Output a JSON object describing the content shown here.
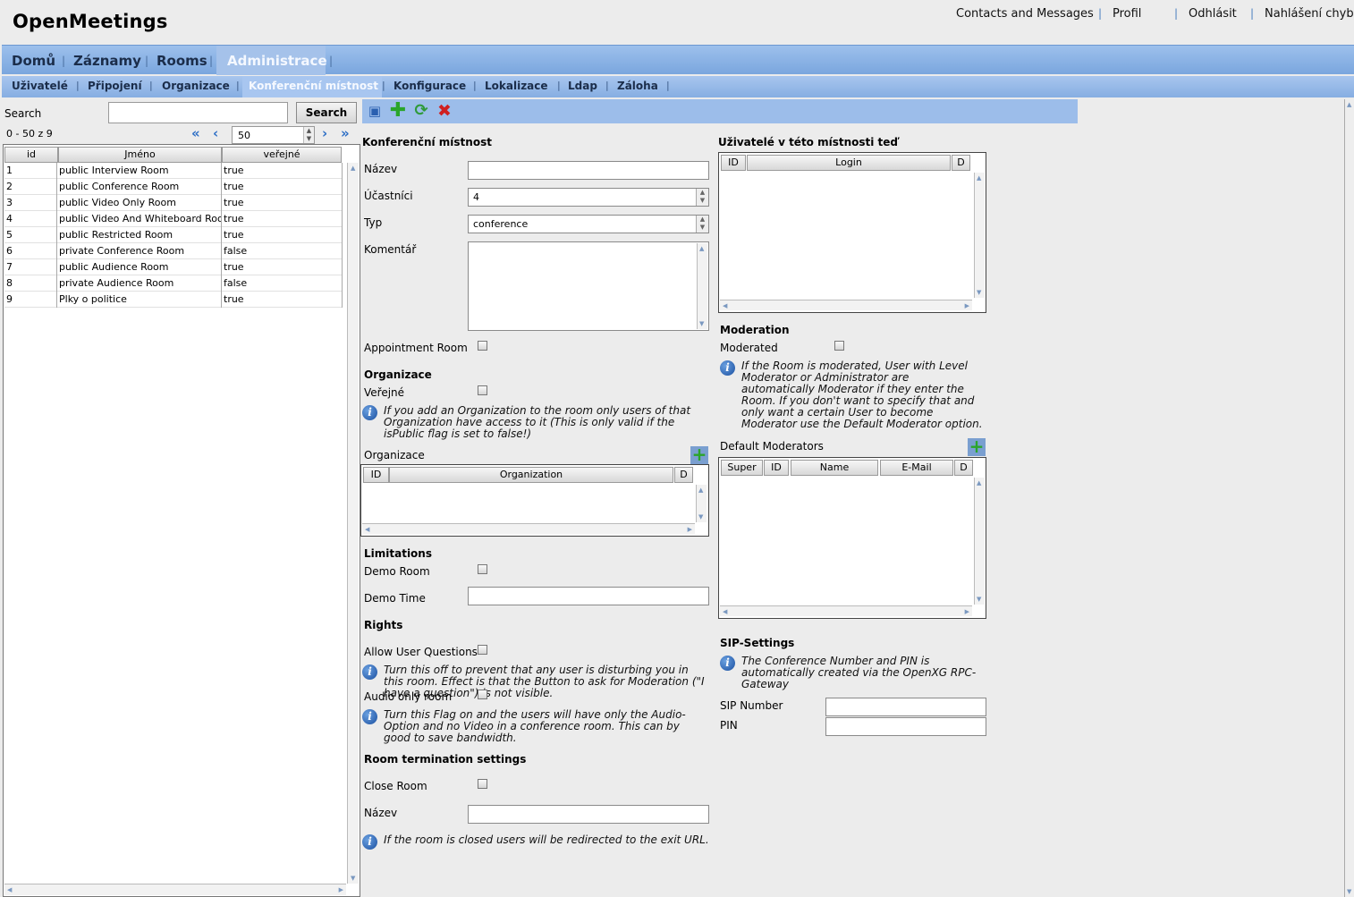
{
  "app": {
    "title": "OpenMeetings"
  },
  "top_links": {
    "contacts": "Contacts and Messages",
    "profile": "Profil",
    "logout": "Odhlásit",
    "report_bug": "Nahlášení chyb!"
  },
  "main_nav": {
    "home": "Domů",
    "recordings": "Záznamy",
    "rooms": "Rooms",
    "admin": "Administrace"
  },
  "sub_nav": {
    "users": "Uživatelé",
    "connections": "Připojení",
    "organizations": "Organizace",
    "rooms": "Konferenční místnost",
    "config": "Konfigurace",
    "languages": "Lokalizace",
    "ldap": "Ldap",
    "backup": "Záloha"
  },
  "search": {
    "label": "Search",
    "value": "",
    "button": "Search"
  },
  "pager": {
    "range": "0 - 50 z 9",
    "page_size": "50"
  },
  "room_table": {
    "headers": {
      "id": "id",
      "name": "Jméno",
      "public": "veřejné"
    },
    "rows": [
      {
        "id": "1",
        "name": "public Interview Room",
        "public": "true"
      },
      {
        "id": "2",
        "name": "public Conference Room",
        "public": "true"
      },
      {
        "id": "3",
        "name": "public Video Only Room",
        "public": "true"
      },
      {
        "id": "4",
        "name": "public Video And Whiteboard Room",
        "public": "true"
      },
      {
        "id": "5",
        "name": "public Restricted Room",
        "public": "true"
      },
      {
        "id": "6",
        "name": "private Conference Room",
        "public": "false"
      },
      {
        "id": "7",
        "name": "public Audience Room",
        "public": "true"
      },
      {
        "id": "8",
        "name": "private Audience Room",
        "public": "false"
      },
      {
        "id": "9",
        "name": "Plky o politice",
        "public": "true"
      }
    ]
  },
  "toolbar": {
    "icons": [
      "save-icon",
      "add-icon",
      "refresh-icon",
      "delete-icon"
    ],
    "colors": {
      "add": "#2aa52a",
      "refresh": "#2f9a3a",
      "delete": "#d02020",
      "save": "#2a5fb0"
    }
  },
  "form": {
    "section_title": "Konferenční místnost",
    "name_label": "Název",
    "name_value": "",
    "participants_label": "Účastníci",
    "participants_value": "4",
    "type_label": "Typ",
    "type_value": "conference",
    "comment_label": "Komentář",
    "comment_value": "",
    "appointment_label": "Appointment Room",
    "org_section": "Organizace",
    "public_label": "Veřejné",
    "org_info": "If you add an Organization to the room only users of that Organization have access to it (This is only valid if the isPublic flag is set to false!)",
    "org_label": "Organizace",
    "org_grid": {
      "id": "ID",
      "organization": "Organization",
      "d": "D"
    },
    "limitations_section": "Limitations",
    "demo_room_label": "Demo Room",
    "demo_time_label": "Demo Time",
    "demo_time_value": "",
    "rights_section": "Rights",
    "allow_questions_label": "Allow User Questions",
    "allow_questions_info": "Turn this off to prevent that any user is disturbing you in this room. Effect is that the Button to ask for Moderation (\"I have a question\") is not visible.",
    "audio_only_label": "Audio only room",
    "audio_only_info": "Turn this Flag on and the users will have only the Audio-Option and no Video in a conference room. This can by good to save bandwidth.",
    "termination_section": "Room termination settings",
    "close_room_label": "Close Room",
    "redirect_label": "Název",
    "redirect_value": "",
    "close_info": "If the room is closed users will be redirected to the exit URL."
  },
  "right": {
    "users_title": "Uživatelé v této místnosti teď",
    "users_grid": {
      "id": "ID",
      "login": "Login",
      "d": "D"
    },
    "moderation_section": "Moderation",
    "moderated_label": "Moderated",
    "moderation_info": "If the Room is moderated, User with Level Moderator or Administrator are automatically Moderator if they enter the Room. If you don't want to specify that and only want a certain User to become Moderator use the Default Moderator option.",
    "default_moderators_label": "Default Moderators",
    "mod_grid": {
      "super": "Super",
      "id": "ID",
      "name": "Name",
      "email": "E-Mail",
      "d": "D"
    },
    "sip_section": "SIP-Settings",
    "sip_info": "The Conference Number and PIN is automatically created via the OpenXG RPC-Gateway",
    "sip_number_label": "SIP Number",
    "sip_number_value": "",
    "pin_label": "PIN",
    "pin_value": ""
  }
}
